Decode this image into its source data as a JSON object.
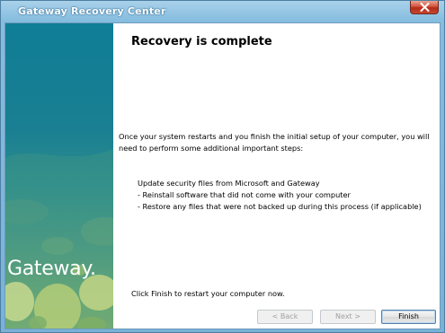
{
  "window": {
    "title": "Gateway Recovery Center"
  },
  "sidebar": {
    "logo_text": "Gateway."
  },
  "main": {
    "heading": "Recovery is complete",
    "intro": "Once your system restarts and you finish the initial setup of your computer, you will need to perform some additional important steps:",
    "steps": [
      "Update security files from Microsoft and Gateway",
      "- Reinstall software that did not come with your computer",
      "- Restore any files that were not backed up during this process (if applicable)"
    ],
    "footer": "Click Finish to restart your computer now."
  },
  "buttons": {
    "back": "< Back",
    "next": "Next >",
    "finish": "Finish"
  },
  "icons": {
    "close": "close-icon"
  },
  "colors": {
    "titlebar": "#86bddf",
    "side_panel_top": "#0f7e97",
    "side_panel_bottom": "#9bbd66",
    "close_button": "#c9472f"
  }
}
